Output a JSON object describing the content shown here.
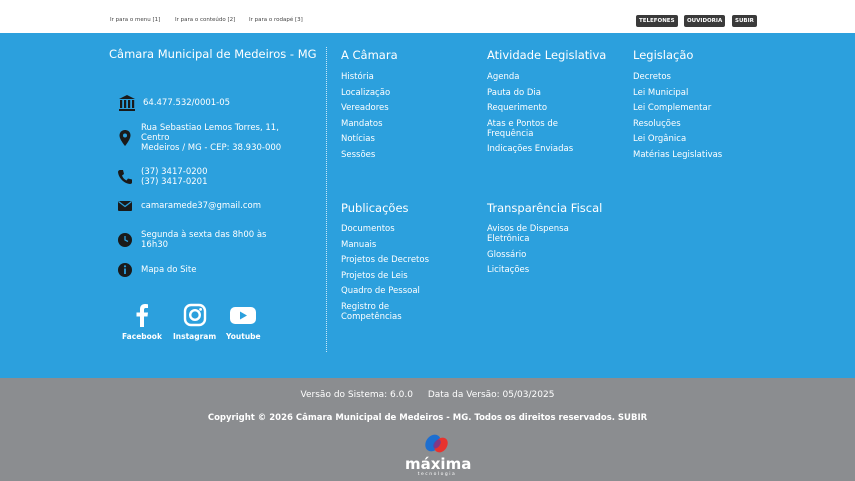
{
  "skip_links": {
    "menu": "Ir para o menu [1]",
    "content": "Ir para o conteúdo [2]",
    "footer": "Ir para o rodapé [3]"
  },
  "top_buttons": {
    "phones": "TELEFONES",
    "ombudsman": "OUVIDORIA",
    "up": "SUBIR"
  },
  "contact": {
    "org_name": "Câmara Municipal de Medeiros - MG",
    "cnpj": "64.477.532/0001-05",
    "address": "Rua Sebastiao Lemos Torres, 11,\nCentro\nMedeiros / MG - CEP: 38.930-000",
    "phones": "(37) 3417-0200\n(37) 3417-0201",
    "email": "camaramede37@gmail.com",
    "hours": "Segunda à sexta das 8h00 às\n16h30",
    "sitemap": "Mapa do Site"
  },
  "social": {
    "facebook": "Facebook",
    "instagram": "Instagram",
    "youtube": "Youtube"
  },
  "nav": {
    "camara": {
      "title": "A Câmara",
      "items": [
        "História",
        "Localização",
        "Vereadores",
        "Mandatos",
        "Notícias",
        "Sessões"
      ]
    },
    "atividade": {
      "title": "Atividade Legislativa",
      "items": [
        "Agenda",
        "Pauta do Dia",
        "Requerimento",
        "Atas e Pontos de Frequência",
        "Indicações Enviadas"
      ]
    },
    "legislacao": {
      "title": "Legislação",
      "items": [
        "Decretos",
        "Lei Municipal",
        "Lei Complementar",
        "Resoluções",
        "Lei Orgânica",
        "Matérias Legislativas"
      ]
    },
    "publicacoes": {
      "title": "Publicações",
      "items": [
        "Documentos",
        "Manuais",
        "Projetos de Decretos",
        "Projetos de Leis",
        "Quadro de Pessoal",
        "Registro de Competências"
      ]
    },
    "transparencia": {
      "title": "Transparência Fiscal",
      "items": [
        "Avisos de Dispensa Eletrônica",
        "Glossário",
        "Licitações"
      ]
    }
  },
  "bottom": {
    "version": "Versão do Sistema: 6.0.0",
    "version_date": "Data da Versão: 05/03/2025",
    "copyright": "Copyright © 2026 Câmara Municipal de Medeiros - MG. Todos os direitos reservados. SUBIR",
    "logo_word": "máxima",
    "logo_sub": "tecnologia"
  },
  "colors": {
    "footer_blue": "#2ca0dd",
    "bottom_grey": "#8b8d90",
    "pill_dark": "#3a3a3a"
  }
}
